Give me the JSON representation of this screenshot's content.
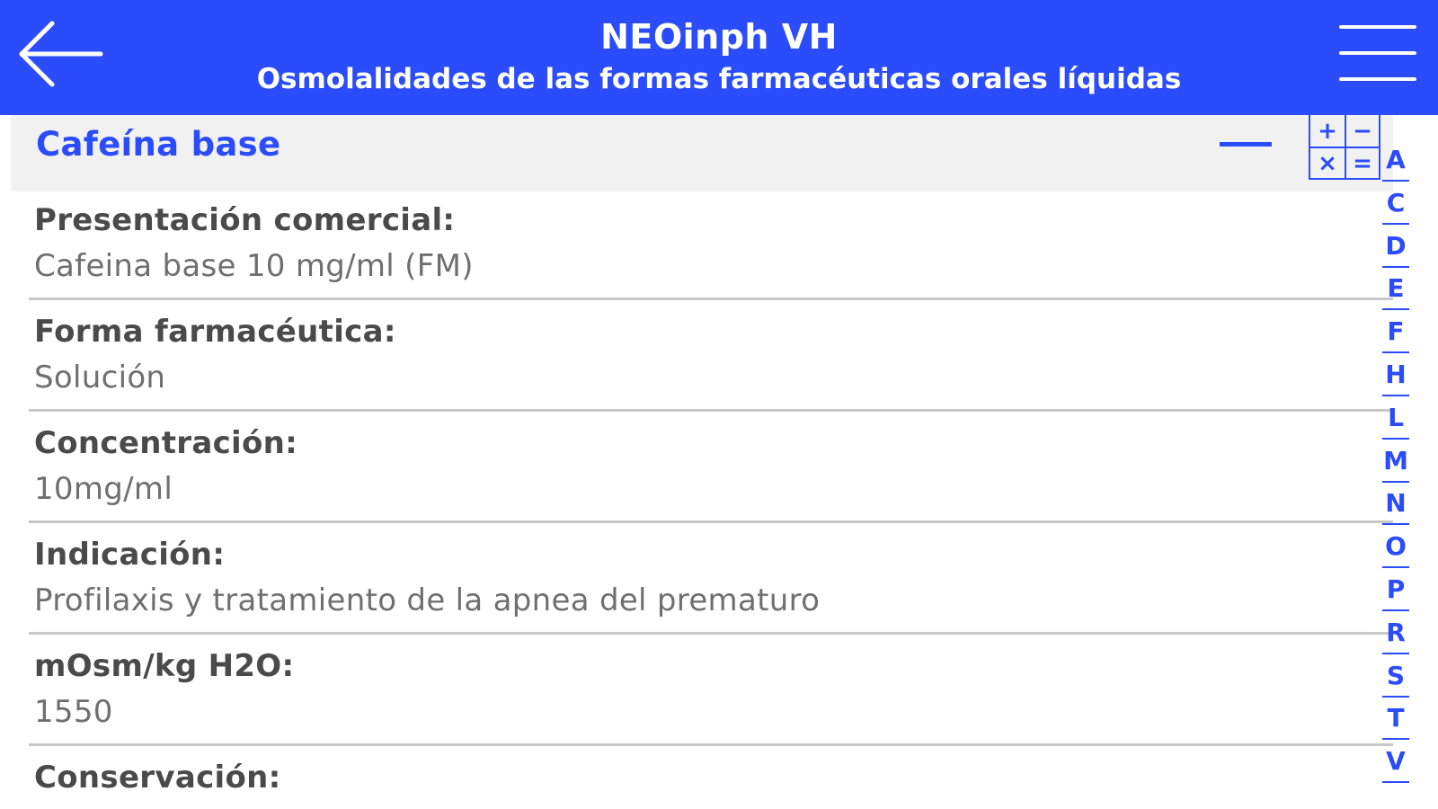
{
  "header": {
    "title": "NEOinph VH",
    "subtitle": "Osmolalidades de las formas farmacéuticas orales líquidas",
    "back_icon": "back-arrow-icon",
    "menu_icon": "hamburger-menu-icon",
    "color": "#2a4cfb"
  },
  "section": {
    "title": "Cafeína base",
    "collapse_icon": "minus-icon",
    "calculator_icon": "calculator-icon",
    "calculator_symbols": [
      "+",
      "−",
      "×",
      "="
    ]
  },
  "fields": [
    {
      "label": "Presentación comercial:",
      "value": "Cafeina base 10 mg/ml (FM)"
    },
    {
      "label": "Forma farmacéutica:",
      "value": "Solución"
    },
    {
      "label": "Concentración:",
      "value": "10mg/ml"
    },
    {
      "label": "Indicación:",
      "value": "Profilaxis y tratamiento de la apnea del prematuro"
    },
    {
      "label": "mOsm/kg H2O:",
      "value": "1550"
    },
    {
      "label": "Conservación:",
      "value": ""
    }
  ],
  "alpha_index": [
    "A",
    "C",
    "D",
    "E",
    "F",
    "H",
    "L",
    "M",
    "N",
    "O",
    "P",
    "R",
    "S",
    "T",
    "V"
  ]
}
